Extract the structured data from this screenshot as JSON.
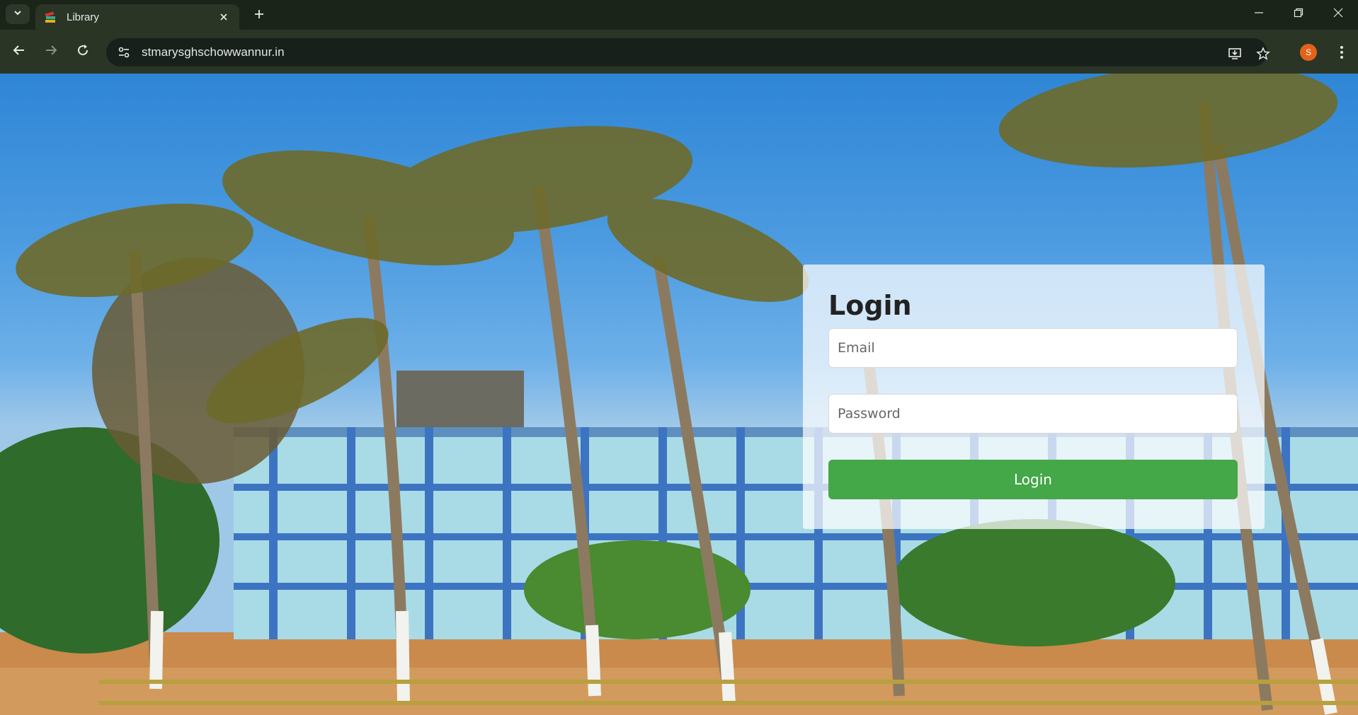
{
  "browser": {
    "tab": {
      "title": "Library",
      "favicon": "books-icon"
    },
    "address": {
      "url": "stmarysghschowwannur.in"
    },
    "profile": {
      "initial": "S",
      "color": "#e3621a"
    }
  },
  "icons": {
    "tab_search": "chevron-down-icon",
    "tab_close": "close-icon",
    "new_tab": "plus-icon",
    "minimize": "minimize-icon",
    "restore": "restore-icon",
    "close_window": "close-icon",
    "back": "arrow-left-icon",
    "forward": "arrow-right-icon",
    "reload": "reload-icon",
    "site_info": "tune-icon",
    "install": "install-app-icon",
    "bookmark": "star-icon",
    "menu": "kebab-menu-icon"
  },
  "login": {
    "title": "Login",
    "email_placeholder": "Email",
    "password_placeholder": "Password",
    "button_label": "Login",
    "button_color": "#44a748"
  }
}
